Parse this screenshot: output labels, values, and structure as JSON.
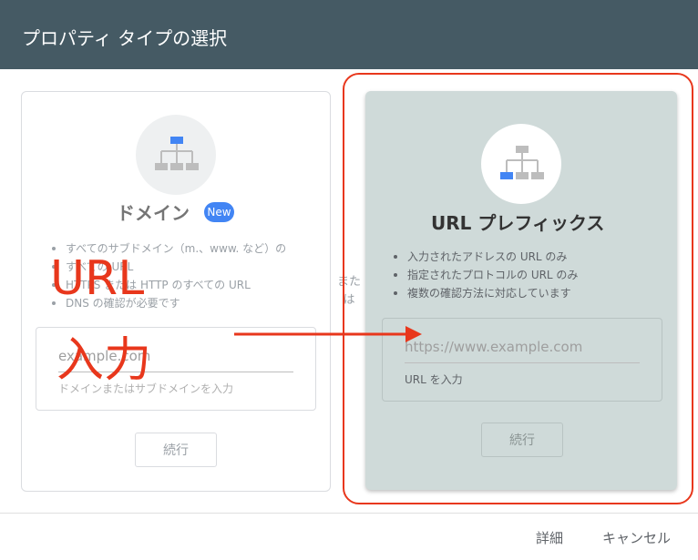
{
  "header": {
    "title": "プロパティ タイプの選択"
  },
  "domain_card": {
    "title": "ドメイン",
    "badge": "New",
    "bullets": [
      "すべてのサブドメイン（m.、www. など）の",
      "すべての URL",
      "HTTPS または HTTP のすべての URL",
      "DNS の確認が必要です"
    ],
    "input_placeholder": "example.com",
    "input_label": "ドメインまたはサブドメインを入力",
    "continue_label": "続行"
  },
  "or_label": "または",
  "url_card": {
    "title": "URL プレフィックス",
    "bullets": [
      "入力されたアドレスの URL のみ",
      "指定されたプロトコルの URL のみ",
      "複数の確認方法に対応しています"
    ],
    "input_placeholder": "https://www.example.com",
    "input_label": "URL を入力",
    "continue_label": "続行"
  },
  "footer": {
    "details_label": "詳細",
    "cancel_label": "キャンセル"
  },
  "annotation": {
    "line1": "URL",
    "line2": "入力"
  },
  "colors": {
    "header": "#455a64",
    "selected_card": "#cfdad9",
    "accent_blue": "#4285f4",
    "annotation_red": "#e8371c"
  }
}
